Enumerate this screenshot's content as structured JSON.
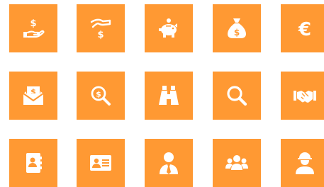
{
  "theme": {
    "tile_color": "#FF9933",
    "icon_color": "#FFFFFF"
  },
  "icons": {
    "dollar_sign": "$",
    "euro_sign": "€"
  },
  "grid": [
    [
      "hand-holding-dollar-icon",
      "hand-receiving-dollar-icon",
      "piggy-bank-icon",
      "money-bag-icon",
      "euro-icon"
    ],
    [
      "money-envelope-icon",
      "dollar-search-icon",
      "binoculars-icon",
      "search-icon",
      "handshake-icon"
    ],
    [
      "address-book-icon",
      "id-card-icon",
      "businessman-icon",
      "team-icon",
      "worker-helmet-icon"
    ]
  ]
}
